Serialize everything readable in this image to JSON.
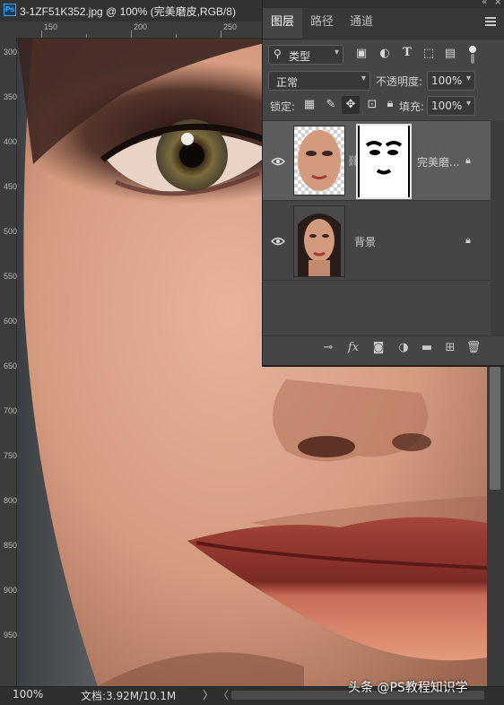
{
  "document": {
    "title": "3-1ZF51K352.jpg @ 100% (完美磨皮,RGB/8)",
    "ps_logo": "Ps"
  },
  "rulers": {
    "top_labels": [
      "150",
      "200",
      "250",
      "300"
    ],
    "left_labels": [
      "300",
      "350",
      "400",
      "450",
      "500",
      "550",
      "600",
      "650",
      "700",
      "750",
      "800",
      "850",
      "900",
      "950"
    ]
  },
  "status": {
    "zoom": "100%",
    "doc_info": "文档:3.92M/10.1M",
    "arrow": "〉",
    "scroll_left": "〈"
  },
  "watermark": "头条 @PS教程知识学",
  "panel": {
    "tabs": [
      {
        "label": "图层",
        "active": true
      },
      {
        "label": "路径",
        "active": false
      },
      {
        "label": "通道",
        "active": false
      }
    ],
    "collapse_icon": "double-chevron-left-icon",
    "filter": {
      "label": "类型",
      "icons": [
        "image-filter-icon",
        "adjustment-filter-icon",
        "type-filter-icon",
        "shape-filter-icon",
        "smart-object-filter-icon",
        "toggle-filter-icon"
      ]
    },
    "blend_mode": "正常",
    "opacity_label": "不透明度:",
    "opacity_value": "100%",
    "lock_label": "锁定:",
    "fill_label": "填充:",
    "fill_value": "100%",
    "layers": [
      {
        "name": "完美磨...",
        "selected": true,
        "visible": true,
        "has_mask": true,
        "locked": true
      },
      {
        "name": "背景",
        "selected": false,
        "visible": true,
        "has_mask": false,
        "locked": true
      }
    ],
    "bottom_icons": [
      "link-layers-icon",
      "fx-icon",
      "add-mask-icon",
      "adjustment-layer-icon",
      "new-group-icon",
      "new-layer-icon",
      "delete-layer-icon"
    ],
    "fx_label": "fx"
  },
  "colors": {
    "panel_bg": "#454545",
    "selected_layer": "#5c5c5c",
    "accent": "#31a8ff"
  }
}
